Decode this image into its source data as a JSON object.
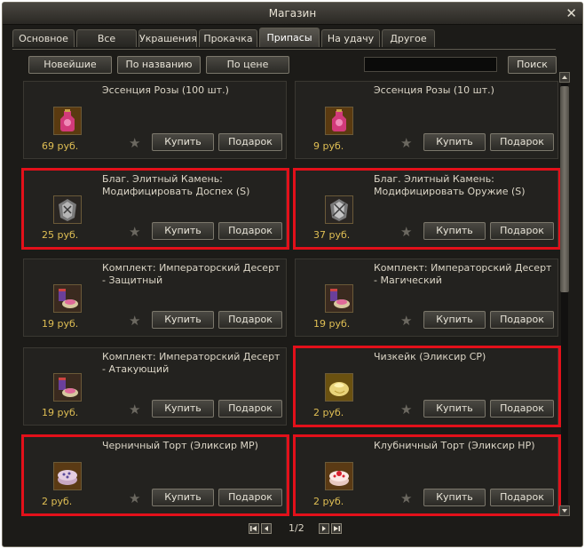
{
  "window": {
    "title": "Магазин",
    "close_glyph": "✕"
  },
  "tabs": [
    {
      "label": "Основное"
    },
    {
      "label": "Все"
    },
    {
      "label": "Украшения"
    },
    {
      "label": "Прокачка"
    },
    {
      "label": "Припасы",
      "active": true
    },
    {
      "label": "На удачу"
    },
    {
      "label": "Другое"
    }
  ],
  "sort": {
    "newest": "Новейшие",
    "by_name": "По названию",
    "by_price": "По цене"
  },
  "search": {
    "value": "",
    "button": "Поиск"
  },
  "card_buttons": {
    "buy": "Купить",
    "gift": "Подарок"
  },
  "items": [
    {
      "name": "Эссенция Розы (100 шт.)",
      "price": "69 руб.",
      "icon": "rose-essence-icon",
      "highlighted": false
    },
    {
      "name": "Эссенция Розы (10 шт.)",
      "price": "9 руб.",
      "icon": "rose-essence-icon",
      "highlighted": false
    },
    {
      "name": "Благ. Элитный Камень: Модифицировать Доспех (S)",
      "price": "25 руб.",
      "icon": "armor-stone-icon",
      "highlighted": true
    },
    {
      "name": "Благ. Элитный Камень: Модифицировать Оружие (S)",
      "price": "37 руб.",
      "icon": "weapon-stone-icon",
      "highlighted": true
    },
    {
      "name": "Комплект: Императорский Десерт - Защитный",
      "price": "19 руб.",
      "icon": "dessert-set-icon",
      "highlighted": false
    },
    {
      "name": "Комплект: Императорский Десерт - Магический",
      "price": "19 руб.",
      "icon": "dessert-set-icon",
      "highlighted": false
    },
    {
      "name": "Комплект: Императорский Десерт - Атакующий",
      "price": "19 руб.",
      "icon": "dessert-set-icon",
      "highlighted": false
    },
    {
      "name": "Чизкейк (Эликсир CP)",
      "price": "2 руб.",
      "icon": "cheesecake-icon",
      "highlighted": true
    },
    {
      "name": "Черничный Торт (Эликсир MP)",
      "price": "2 руб.",
      "icon": "blueberry-cake-icon",
      "highlighted": true
    },
    {
      "name": "Клубничный Торт (Эликсир HP)",
      "price": "2 руб.",
      "icon": "strawberry-cake-icon",
      "highlighted": true
    }
  ],
  "pagination": {
    "text": "1/2",
    "current": 1,
    "total": 2
  },
  "colors": {
    "price": "#e0bf54",
    "highlight": "#e3101a",
    "panel": "#23221f"
  }
}
